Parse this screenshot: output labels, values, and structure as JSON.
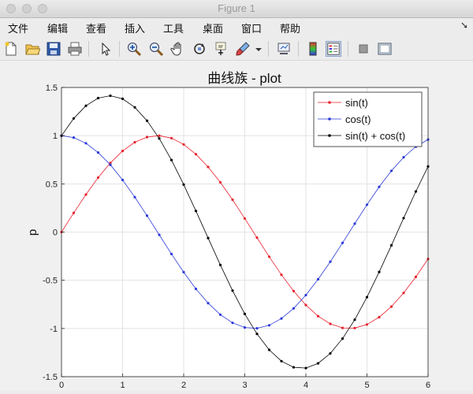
{
  "window": {
    "title": "Figure 1"
  },
  "menu": [
    "文件",
    "编辑",
    "查看",
    "插入",
    "工具",
    "桌面",
    "窗口",
    "帮助"
  ],
  "menu_right_icon": "dock-arrow-icon",
  "toolbar_icons": [
    "new-figure-icon",
    "open-file-icon",
    "save-icon",
    "print-icon",
    "select-arrow-icon",
    "zoom-in-icon",
    "zoom-out-icon",
    "pan-hand-icon",
    "rotate-3d-icon",
    "data-cursor-icon",
    "brush-icon",
    "brush-dropdown-icon",
    "link-plot-icon",
    "colorbar-icon",
    "legend-icon",
    "hide-tools-icon",
    "show-tools-icon"
  ],
  "chart_data": {
    "type": "line",
    "title": "曲线族 - plot",
    "ylabel": "p",
    "xlabel": "",
    "xlim": [
      0,
      6
    ],
    "ylim": [
      -1.5,
      1.5
    ],
    "xticks": [
      "0",
      "1",
      "2",
      "3",
      "4",
      "5",
      "6"
    ],
    "yticks": [
      "-1.5",
      "-1",
      "-0.5",
      "0",
      "0.5",
      "1",
      "1.5"
    ],
    "grid": true,
    "legend_position": "top-right",
    "x": [
      0,
      0.2,
      0.4,
      0.6,
      0.8,
      1.0,
      1.2,
      1.4,
      1.6,
      1.8,
      2.0,
      2.2,
      2.4,
      2.6,
      2.8,
      3.0,
      3.2,
      3.4,
      3.6,
      3.8,
      4.0,
      4.2,
      4.4,
      4.6,
      4.8,
      5.0,
      5.2,
      5.4,
      5.6,
      5.8,
      6.0
    ],
    "series": [
      {
        "name": "sin(t)",
        "color": "#e8222d",
        "values": [
          0,
          0.199,
          0.389,
          0.565,
          0.717,
          0.841,
          0.932,
          0.985,
          1.0,
          0.974,
          0.909,
          0.808,
          0.675,
          0.516,
          0.335,
          0.141,
          -0.058,
          -0.256,
          -0.443,
          -0.612,
          -0.757,
          -0.872,
          -0.952,
          -0.994,
          -0.996,
          -0.959,
          -0.883,
          -0.773,
          -0.631,
          -0.465,
          -0.279
        ]
      },
      {
        "name": "cos(t)",
        "color": "#2b3bd8",
        "values": [
          1.0,
          0.98,
          0.921,
          0.825,
          0.697,
          0.54,
          0.362,
          0.17,
          -0.029,
          -0.227,
          -0.416,
          -0.589,
          -0.737,
          -0.857,
          -0.942,
          -0.99,
          -0.998,
          -0.967,
          -0.897,
          -0.791,
          -0.654,
          -0.49,
          -0.307,
          -0.112,
          0.087,
          0.284,
          0.469,
          0.635,
          0.776,
          0.886,
          0.96
        ]
      },
      {
        "name": "sin(t) + cos(t)",
        "color": "#000000",
        "values": [
          1.0,
          1.179,
          1.31,
          1.39,
          1.414,
          1.382,
          1.294,
          1.155,
          0.971,
          0.747,
          0.493,
          0.219,
          -0.062,
          -0.341,
          -0.607,
          -0.849,
          -1.056,
          -1.222,
          -1.339,
          -1.403,
          -1.411,
          -1.362,
          -1.259,
          -1.105,
          -0.909,
          -0.675,
          -0.414,
          -0.138,
          0.145,
          0.421,
          0.681
        ]
      }
    ]
  }
}
